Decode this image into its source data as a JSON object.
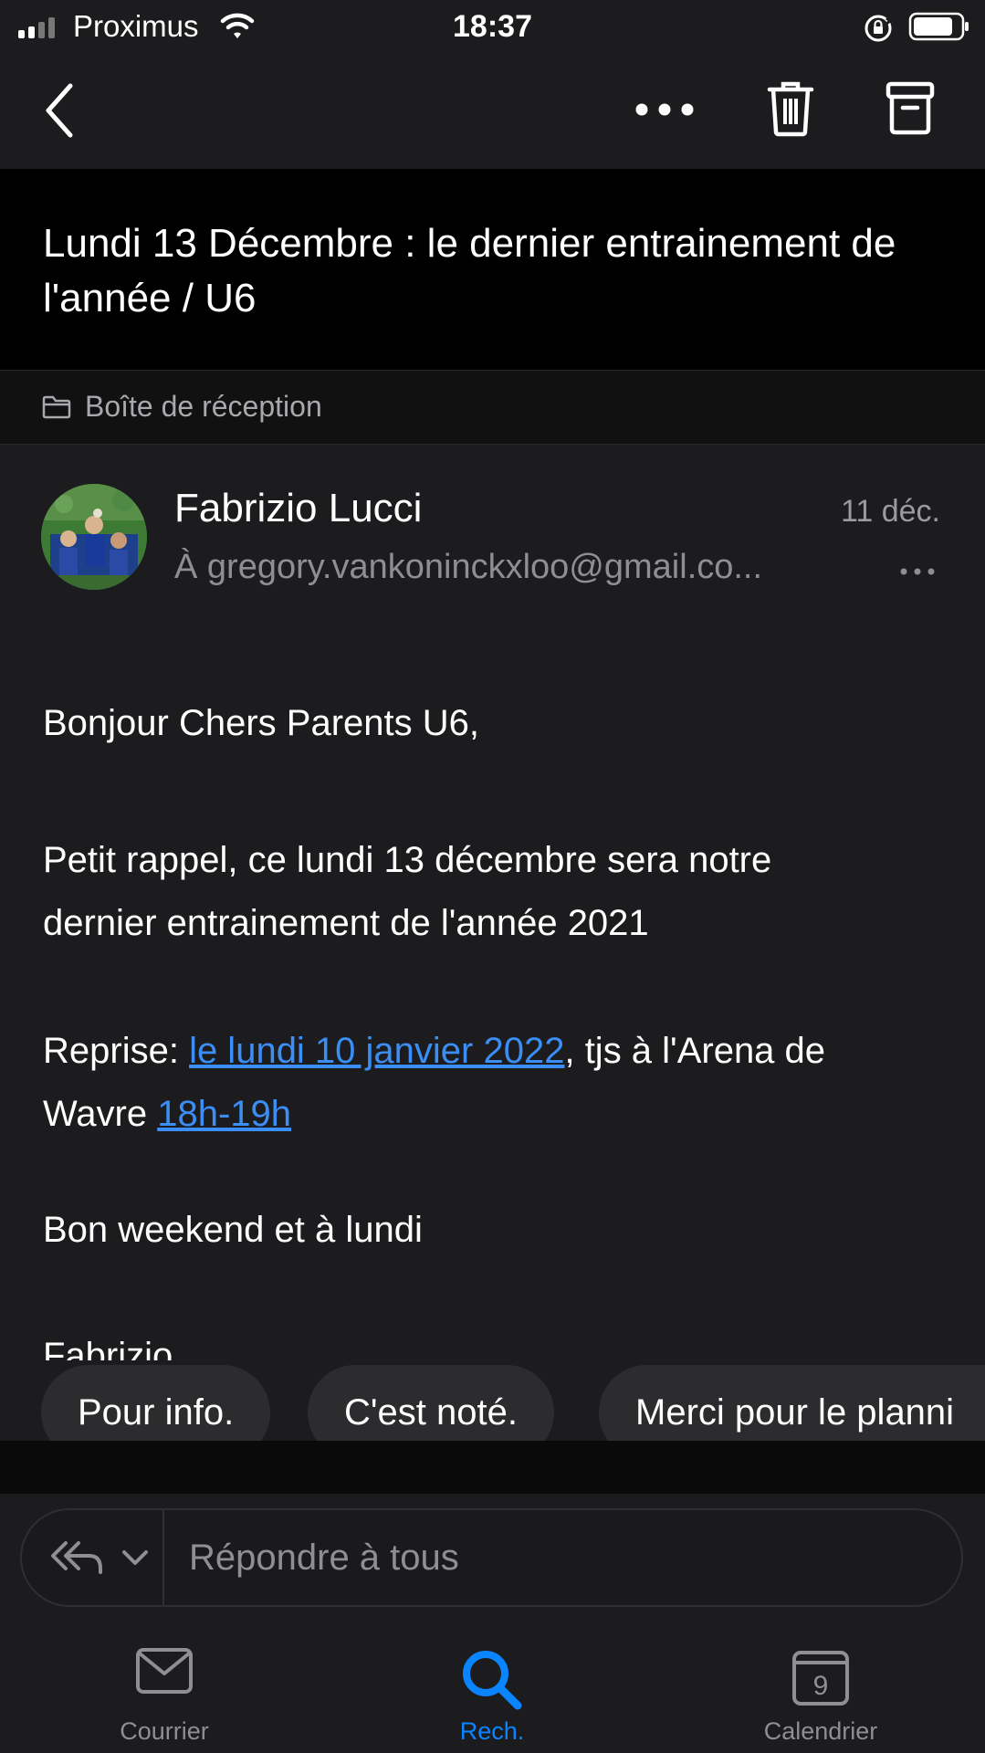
{
  "status_bar": {
    "carrier": "Proximus",
    "time": "18:37"
  },
  "toolbar": {
    "back_icon": "chevron-left-icon",
    "more_icon": "more-horizontal-icon",
    "delete_icon": "trash-icon",
    "archive_icon": "archive-box-icon"
  },
  "email": {
    "subject": "Lundi 13 Décembre : le dernier entrainement de l'année / U6",
    "folder": "Boîte de réception",
    "sender": "Fabrizio Lucci",
    "date": "11 déc.",
    "recipient": "À gregory.vankoninckxloo@gmail.co...",
    "body": {
      "greeting": "Bonjour Chers Parents U6,",
      "p2_line1": "Petit rappel, ce lundi 13 décembre sera notre",
      "p2_line2": "dernier entrainement de l'année 2021",
      "p3_prefix": "Reprise: ",
      "p3_link_date": "le lundi 10 janvier 2022",
      "p3_mid": ", tjs à l'Arena de",
      "p3_line2_prefix": "Wavre ",
      "p3_link_time": "18h-19h",
      "p4": "Bon weekend et à lundi",
      "signature": "Fabrizio"
    }
  },
  "quick_replies": [
    "Pour info.",
    "C'est noté.",
    "Merci pour le planni"
  ],
  "reply": {
    "placeholder": "Répondre à tous"
  },
  "tabs": [
    {
      "label": "Courrier",
      "icon": "mail-icon",
      "active": false
    },
    {
      "label": "Rech.",
      "icon": "search-icon",
      "active": true
    },
    {
      "label": "Calendrier",
      "icon": "calendar-icon",
      "active": false,
      "badge": "9"
    }
  ],
  "colors": {
    "accent": "#0a84ff",
    "link": "#3a8ef5",
    "background": "#1c1c1e"
  }
}
